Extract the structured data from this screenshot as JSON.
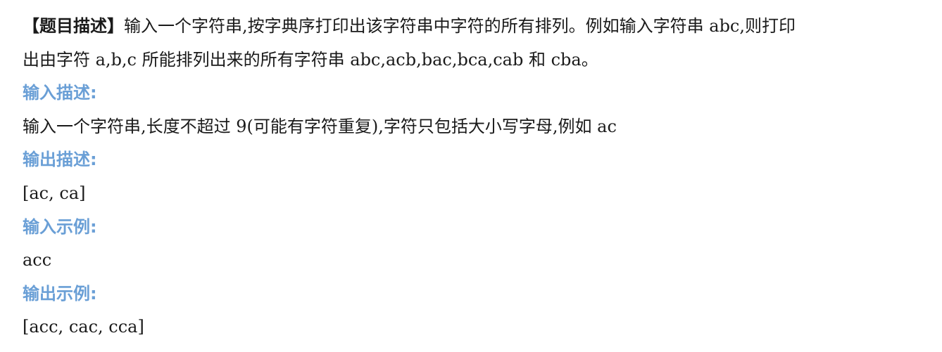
{
  "problem": {
    "label": "【题目描述】",
    "description_line1": "输入一个字符串,按字典序打印出该字符串中字符的所有排列。例如输入字符串 abc,则打印",
    "description_line2": "出由字符 a,b,c 所能排列出来的所有字符串 abc,acb,bac,bca,cab 和 cba。"
  },
  "input_description": {
    "heading": "输入描述:",
    "text": "输入一个字符串,长度不超过 9(可能有字符重复),字符只包括大小写字母,例如 ac"
  },
  "output_description": {
    "heading": "输出描述:",
    "text": "[ac, ca]"
  },
  "input_example": {
    "heading": "输入示例:",
    "text": "acc"
  },
  "output_example": {
    "heading": "输出示例:",
    "text": "[acc, cac, cca]"
  }
}
